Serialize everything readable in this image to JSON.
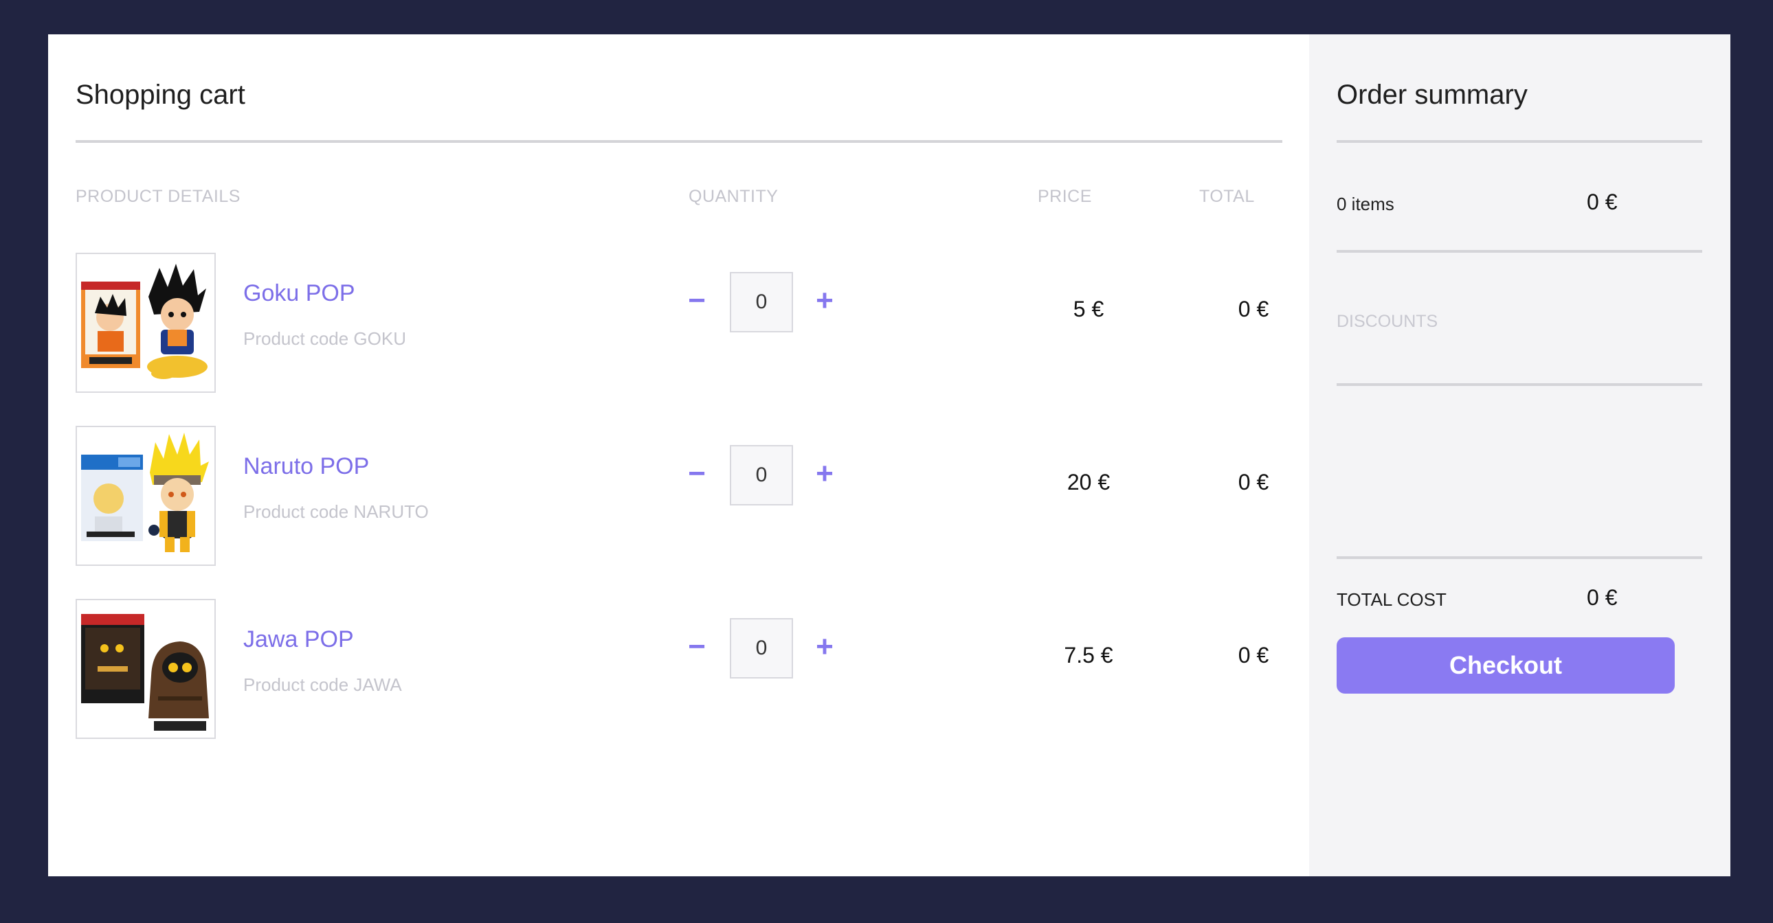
{
  "cart": {
    "title": "Shopping cart",
    "columns": {
      "product_details": "PRODUCT DETAILS",
      "quantity": "QUANTITY",
      "price": "PRICE",
      "total": "TOTAL"
    },
    "items": [
      {
        "name": "Goku POP",
        "code": "Product code GOKU",
        "quantity": "0",
        "price": "5 €",
        "total": "0 €",
        "minus": "−",
        "plus": "+"
      },
      {
        "name": "Naruto POP",
        "code": "Product code NARUTO",
        "quantity": "0",
        "price": "20 €",
        "total": "0 €",
        "minus": "−",
        "plus": "+"
      },
      {
        "name": "Jawa POP",
        "code": "Product code JAWA",
        "quantity": "0",
        "price": "7.5 €",
        "total": "0 €",
        "minus": "−",
        "plus": "+"
      }
    ]
  },
  "summary": {
    "title": "Order summary",
    "items_label": "0 items",
    "items_value": "0 €",
    "discounts_label": "DISCOUNTS",
    "total_label": "TOTAL COST",
    "total_value": "0 €",
    "checkout_label": "Checkout"
  },
  "colors": {
    "background": "#212441",
    "accent": "#8a7af2",
    "link": "#7c6ee8",
    "muted": "#c4c4cc",
    "summary_bg": "#f4f4f6"
  }
}
